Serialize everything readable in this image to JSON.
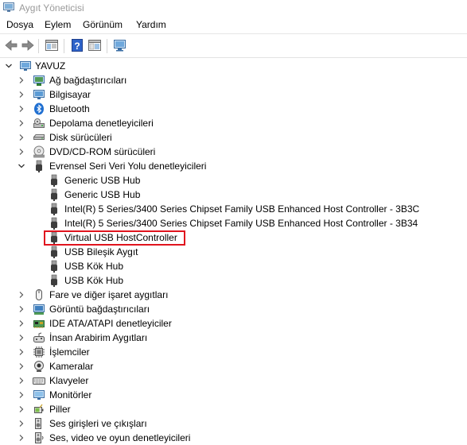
{
  "window": {
    "title": "Aygıt Yöneticisi"
  },
  "menu": {
    "items": [
      "Dosya",
      "Eylem",
      "Görünüm",
      "Yardım"
    ]
  },
  "tree": {
    "root": "YAVUZ",
    "categories": [
      {
        "label": "Ağ bağdaştırıcıları",
        "icon": "network-adapter-icon"
      },
      {
        "label": "Bilgisayar",
        "icon": "computer-icon"
      },
      {
        "label": "Bluetooth",
        "icon": "bluetooth-icon"
      },
      {
        "label": "Depolama denetleyicileri",
        "icon": "storage-controller-icon"
      },
      {
        "label": "Disk sürücüleri",
        "icon": "disk-drive-icon"
      },
      {
        "label": "DVD/CD-ROM sürücüleri",
        "icon": "dvd-icon"
      },
      {
        "label": "Evrensel Seri Veri Yolu denetleyicileri",
        "icon": "usb-icon"
      }
    ],
    "usb_children": [
      "Generic USB Hub",
      "Generic USB Hub",
      "Intel(R) 5 Series/3400 Series Chipset Family USB Enhanced Host Controller - 3B3C",
      "Intel(R) 5 Series/3400 Series Chipset Family USB Enhanced Host Controller - 3B34",
      "Virtual USB HostController",
      "USB Bileşik Aygıt",
      "USB Kök Hub",
      "USB Kök Hub"
    ],
    "categories_after": [
      {
        "label": "Fare ve diğer işaret aygıtları",
        "icon": "mouse-icon"
      },
      {
        "label": "Görüntü bağdaştırıcıları",
        "icon": "display-adapter-icon"
      },
      {
        "label": "IDE ATA/ATAPI denetleyiciler",
        "icon": "ide-controller-icon"
      },
      {
        "label": "İnsan Arabirim Aygıtları",
        "icon": "hid-icon"
      },
      {
        "label": "İşlemciler",
        "icon": "processor-icon"
      },
      {
        "label": "Kameralar",
        "icon": "camera-icon"
      },
      {
        "label": "Klavyeler",
        "icon": "keyboard-icon"
      },
      {
        "label": "Monitörler",
        "icon": "monitor-icon"
      },
      {
        "label": "Piller",
        "icon": "battery-icon"
      },
      {
        "label": "Ses girişleri ve çıkışları",
        "icon": "audio-io-icon"
      },
      {
        "label": "Ses, video ve oyun denetleyicileri",
        "icon": "sound-controller-icon"
      }
    ],
    "highlighted_item": "Virtual USB HostController"
  },
  "colors": {
    "highlight_border": "#e0141e",
    "title_text": "#9a9a9a"
  }
}
